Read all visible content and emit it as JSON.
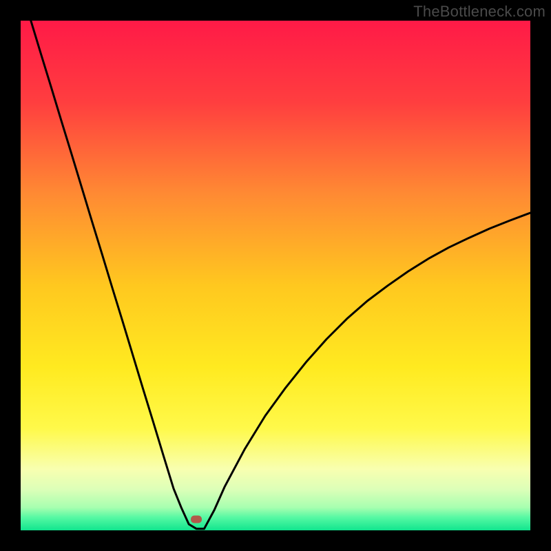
{
  "watermark": {
    "text": "TheBottleneck.com"
  },
  "chart_data": {
    "type": "line",
    "title": "",
    "xlabel": "",
    "ylabel": "",
    "xlim": [
      0,
      100
    ],
    "ylim": [
      0,
      100
    ],
    "series": [
      {
        "name": "bottleneck-curve",
        "x": [
          2,
          4,
          6,
          8,
          10,
          12,
          14,
          16,
          18,
          20,
          22,
          24,
          26,
          28,
          30,
          31.5,
          33,
          34.5,
          36,
          38,
          40,
          44,
          48,
          52,
          56,
          60,
          64,
          68,
          72,
          76,
          80,
          84,
          88,
          92,
          96,
          100
        ],
        "values": [
          100,
          93.4,
          86.9,
          80.3,
          73.8,
          67.2,
          60.6,
          54.1,
          47.5,
          41.0,
          34.4,
          27.8,
          21.3,
          14.7,
          8.2,
          4.5,
          1.2,
          0.3,
          0.3,
          4.0,
          8.5,
          16.0,
          22.5,
          28.0,
          33.0,
          37.5,
          41.5,
          45.0,
          48.0,
          50.8,
          53.3,
          55.5,
          57.4,
          59.2,
          60.8,
          62.3
        ]
      }
    ],
    "marker": {
      "x": 34.5,
      "y": 2.2,
      "color": "#b05a4a"
    },
    "gradient_stops": [
      {
        "offset": 0,
        "color": "#ff1a47"
      },
      {
        "offset": 16,
        "color": "#ff3e3f"
      },
      {
        "offset": 34,
        "color": "#ff8a33"
      },
      {
        "offset": 52,
        "color": "#ffc81f"
      },
      {
        "offset": 68,
        "color": "#ffea20"
      },
      {
        "offset": 80,
        "color": "#fff94a"
      },
      {
        "offset": 88,
        "color": "#f8ffb0"
      },
      {
        "offset": 92,
        "color": "#dcffb8"
      },
      {
        "offset": 95.5,
        "color": "#a8ffb0"
      },
      {
        "offset": 97.5,
        "color": "#55f8a3"
      },
      {
        "offset": 100,
        "color": "#11e58e"
      }
    ]
  }
}
